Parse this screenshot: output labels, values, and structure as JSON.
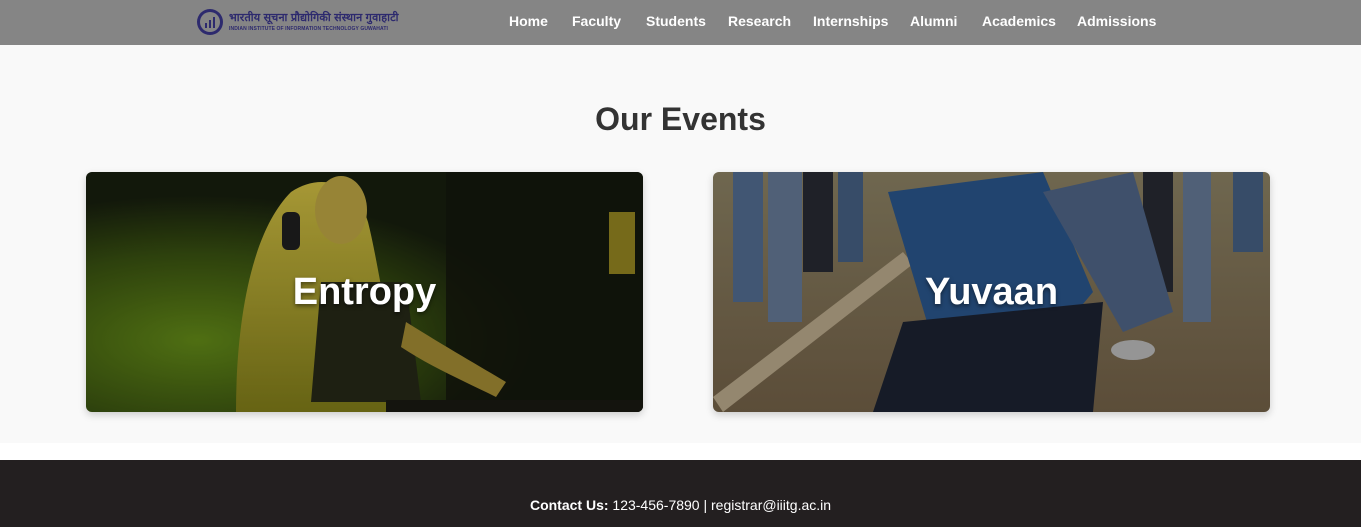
{
  "navbar": {
    "logo": {
      "hindi_text": "भारतीय सूचना प्रौद्योगिकी संस्थान गुवाहाटी",
      "english_text": "INDIAN INSTITUTE OF INFORMATION TECHNOLOGY GUWAHATI"
    },
    "links": [
      {
        "label": "Home"
      },
      {
        "label": "Faculty"
      },
      {
        "label": "Students"
      },
      {
        "label": "Research"
      },
      {
        "label": "Internships"
      },
      {
        "label": "Alumni"
      },
      {
        "label": "Academics"
      },
      {
        "label": "Admissions"
      }
    ],
    "background_color": "#858585"
  },
  "events": {
    "heading": "Our Events",
    "cards": [
      {
        "title": "Entropy",
        "image": "dj-performer-photo"
      },
      {
        "title": "Yuvaan",
        "image": "tug-of-war-photo"
      }
    ]
  },
  "footer": {
    "contact_label": "Contact Us:",
    "contact_details": "123-456-7890 | registrar@iiitg.ac.in",
    "background_color": "#231f20"
  }
}
